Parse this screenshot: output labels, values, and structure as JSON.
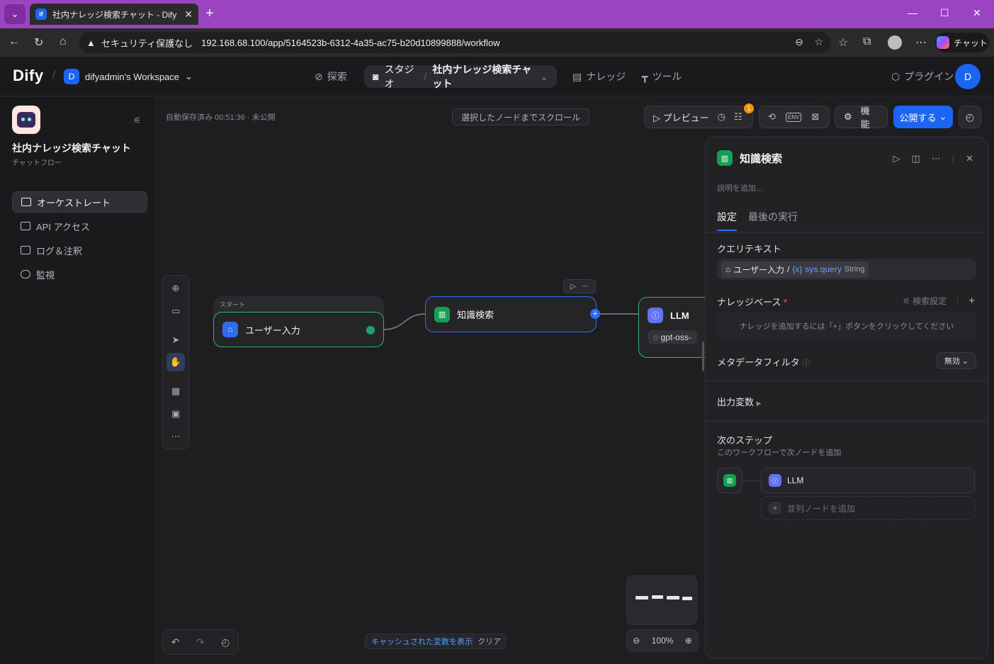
{
  "browser": {
    "tab_title": "社内ナレッジ検索チャット - Dify",
    "tab_favicon": "if",
    "security_label": "セキュリティ保護なし",
    "url": "192.168.68.100/app/5164523b-6312-4a35-ac75-b20d10899888/workflow",
    "chat_label": "チャット"
  },
  "topnav": {
    "logo": "Dify",
    "workspace_badge": "D",
    "workspace": "difyadmin's Workspace",
    "explore": "探索",
    "studio": "スタジオ",
    "current_app": "社内ナレッジ検索チャット",
    "knowledge": "ナレッジ",
    "tools": "ツール",
    "plugins": "プラグイン",
    "avatar": "D"
  },
  "sidebar": {
    "app_name": "社内ナレッジ検索チャット",
    "app_type": "チャットフロー",
    "items": [
      {
        "label": "オーケストレート",
        "icon": "layout-icon",
        "active": true
      },
      {
        "label": "API アクセス",
        "icon": "terminal-icon",
        "active": false
      },
      {
        "label": "ログ＆注釈",
        "icon": "log-icon",
        "active": false
      },
      {
        "label": "監視",
        "icon": "gauge-icon",
        "active": false
      }
    ]
  },
  "canvas": {
    "autosave": "自動保存済み 00:51:36 · 未公開",
    "scroll_button": "選択したノードまでスクロール",
    "preview": "プレビュー",
    "notif_count": "1",
    "env": "ENV",
    "features": "機能",
    "publish": "公開する",
    "start_group_label": "スタート",
    "start_node": "ユーザー入力",
    "kb_node": "知識検索",
    "llm_node": "LLM",
    "llm_model": "gpt-oss-",
    "cache_button": "キャッシュされた変数を表示",
    "clear_button": "クリア",
    "zoom": "100%"
  },
  "panel": {
    "title": "知識検索",
    "description_placeholder": "説明を追加...",
    "tabs": [
      "設定",
      "最後の実行"
    ],
    "query_label": "クエリテキスト",
    "query_chip": {
      "node": "ユーザー入力",
      "sep": "/",
      "var_prefix": "{x}",
      "var": "sys.query",
      "type": "String"
    },
    "kb_label": "ナレッジベース",
    "kb_required": "*",
    "search_settings": "検索設定",
    "kb_empty": "ナレッジを追加するには「+」ボタンをクリックしてください",
    "metadata_label": "メタデータフィルタ",
    "metadata_value": "無効",
    "output_vars": "出力変数",
    "next_step_title": "次のステップ",
    "next_step_sub": "このワークフローで次ノードを追加",
    "next_llm": "LLM",
    "add_parallel": "並列ノードを追加"
  },
  "colors": {
    "accent": "#1c64f2",
    "success": "#2fb27a",
    "kb_green": "#12a150",
    "llm_purple": "#6172f3",
    "browser_frame": "#9b44c1"
  }
}
